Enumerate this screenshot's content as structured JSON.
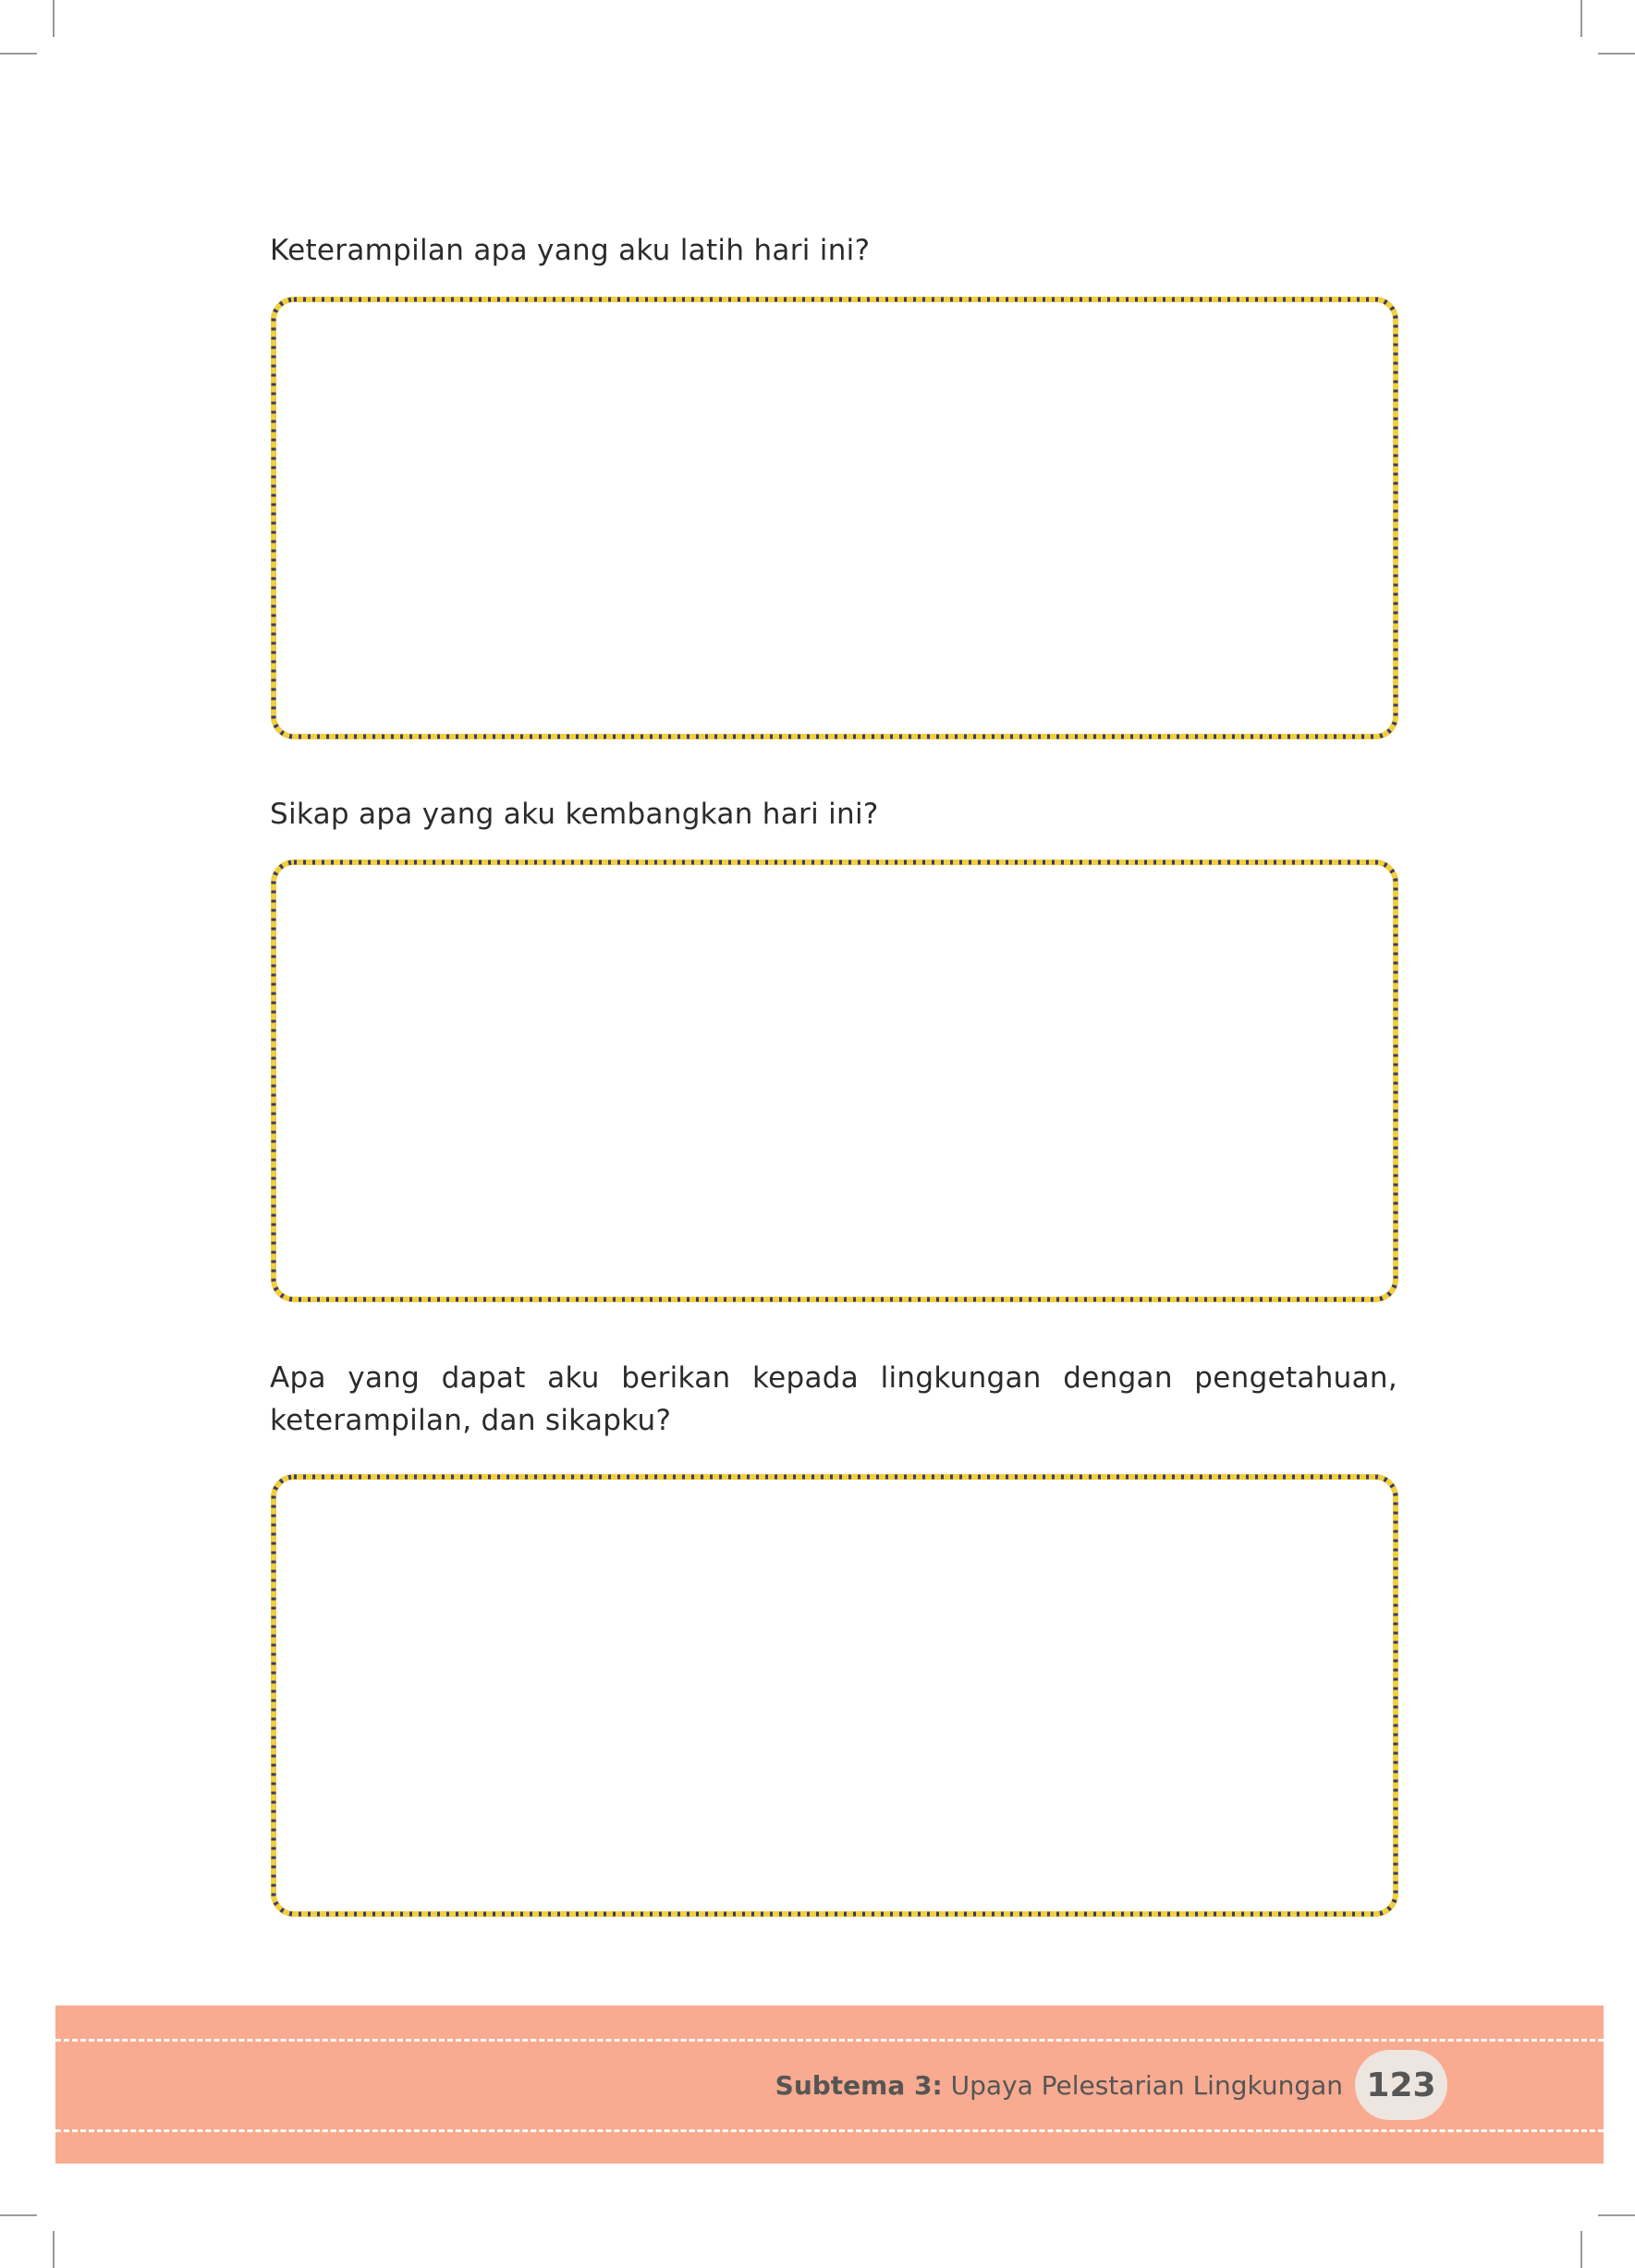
{
  "questions": [
    {
      "text": "Keterampilan apa yang aku latih hari ini?"
    },
    {
      "text": "Sikap apa yang aku kembangkan hari ini?"
    },
    {
      "text": "Apa yang dapat aku berikan kepada lingkungan dengan pengetahuan, keterampilan, dan sikapku?"
    }
  ],
  "answer_box_colors": {
    "yellow": "#f2cf3c",
    "navy": "#3c3a6e"
  },
  "footer": {
    "subtheme_label": "Subtema 3:",
    "subtheme_title": "Upaya Pelestarian Lingkungan",
    "page_number": "123",
    "band_color": "#f8ab90"
  }
}
